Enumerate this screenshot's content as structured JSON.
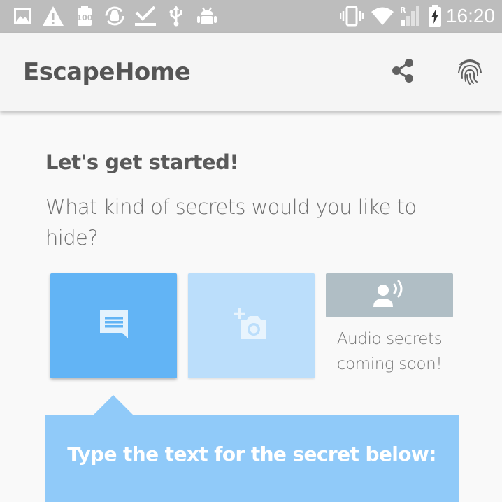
{
  "status_bar": {
    "time": "16:20",
    "left_icons": [
      "image-icon",
      "warning-icon",
      "battery-100-icon",
      "android-sync-icon",
      "download-done-icon",
      "usb-icon",
      "android-debug-icon"
    ],
    "right_icons": [
      "vibrate-icon",
      "wifi-icon",
      "signal-roaming-icon",
      "battery-charging-icon"
    ],
    "roaming_label": "R"
  },
  "app_bar": {
    "title": "EscapeHome",
    "actions": [
      "share-icon",
      "fingerprint-icon"
    ]
  },
  "main": {
    "heading": "Let's get started!",
    "question": "What kind of secrets would you like to hide?",
    "secret_types": [
      {
        "type": "text",
        "icon": "message-icon",
        "selected": true,
        "color": "#62b4f5"
      },
      {
        "type": "image",
        "icon": "add-photo-icon",
        "selected": false,
        "color": "#bbdefb"
      },
      {
        "type": "audio",
        "icon": "record-voice-icon",
        "enabled": false,
        "color": "#b0bec5"
      }
    ],
    "audio_label": "Audio secrets coming soon!",
    "instruction": "Type the text for the secret below:"
  },
  "colors": {
    "status_bar": "#bdbdbd",
    "app_bar": "#f5f5f5",
    "background": "#f9f9f9",
    "accent": "#62b4f5",
    "panel": "#90caf9",
    "disabled": "#b0bec5"
  }
}
